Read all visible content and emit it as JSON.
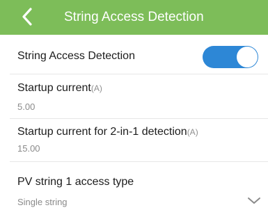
{
  "header": {
    "back_icon": "chevron-left-icon",
    "title": "String Access Detection",
    "background": "#7dbd59"
  },
  "toggle": {
    "label": "String Access Detection",
    "state": "on",
    "accent": "#2d87d6"
  },
  "fields": [
    {
      "label": "Startup current",
      "unit": "(A)",
      "value": "5.00"
    },
    {
      "label": "Startup current for 2-in-1 detection",
      "unit": "(A)",
      "value": "15.00"
    },
    {
      "label": "PV string 1 access type",
      "unit": "",
      "value": "Single string",
      "dropdown_icon": "chevron-down-icon"
    }
  ]
}
